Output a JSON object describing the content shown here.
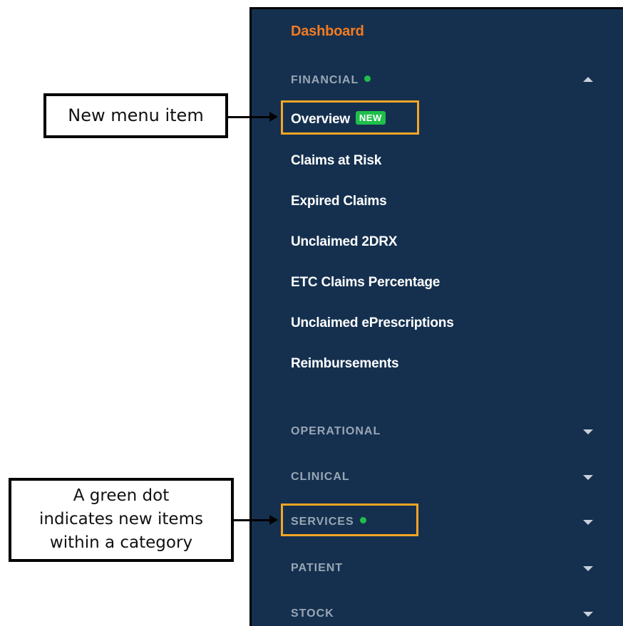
{
  "sidebar": {
    "dashboard": "Dashboard",
    "financial": {
      "label": "FINANCIAL",
      "items": [
        {
          "label": "Overview",
          "badge": "NEW"
        },
        {
          "label": "Claims at Risk"
        },
        {
          "label": "Expired Claims"
        },
        {
          "label": "Unclaimed 2DRX"
        },
        {
          "label": "ETC Claims Percentage"
        },
        {
          "label": "Unclaimed ePrescriptions"
        },
        {
          "label": "Reimbursements"
        }
      ]
    },
    "sections": [
      {
        "label": "OPERATIONAL"
      },
      {
        "label": "CLINICAL"
      },
      {
        "label": "SERVICES"
      },
      {
        "label": "PATIENT"
      },
      {
        "label": "STOCK"
      }
    ]
  },
  "callouts": {
    "new_item": "New menu item",
    "green_dot_line1": "A green dot",
    "green_dot_line2": "indicates new items",
    "green_dot_line3": "within a category"
  },
  "colors": {
    "sidebar_bg": "#15304f",
    "dashboard": "#f47b20",
    "accent_green": "#1fbf4a",
    "highlight": "#f5a524"
  }
}
